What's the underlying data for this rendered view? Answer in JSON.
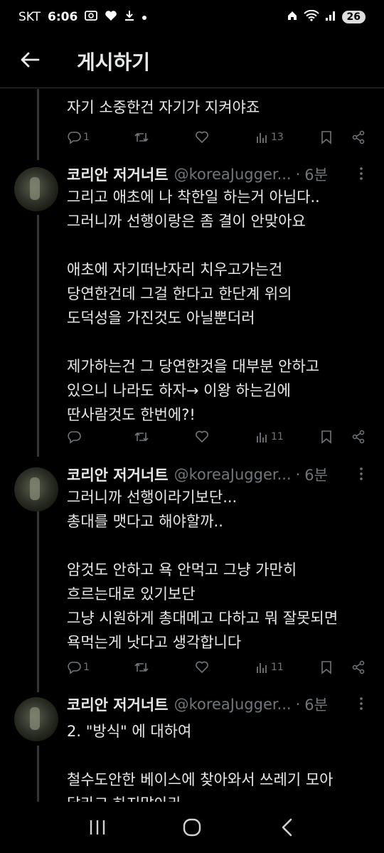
{
  "status_bar": {
    "carrier": "SKT",
    "time": "6:06",
    "battery": "26"
  },
  "header": {
    "title": "게시하기"
  },
  "tweets": [
    {
      "text": "자기 소중한건 자기가 지켜야죠",
      "replies": "1",
      "views": "13"
    },
    {
      "name": "코리안 저거너트",
      "handle": "@koreaJugger...",
      "dot": "·",
      "ago": "6분",
      "text": "그리고 애초에  나 착한일 하는거 아님다..\n그러니까 선행이랑은 좀 결이 안맞아요\n\n애초에 자기떠난자리 치우고가는건\n당연한건데 그걸 한다고  한단계 위의\n도덕성을 가진것도 아닐뿐더러\n\n제가하는건 그 당연한것을  대부분 안하고\n있으니  나라도 하자→ 이왕 하는김에\n딴사람것도 한번에?!",
      "replies": "",
      "views": "11"
    },
    {
      "name": "코리안 저거너트",
      "handle": "@koreaJugger...",
      "dot": "·",
      "ago": "6분",
      "text": "그러니까 선행이라기보단...\n총대를 맷다고 해야할까..\n\n암것도 안하고 욕 안먹고 그냥 가만히\n흐르는대로 있기보단\n그냥 시원하게 총대메고 다하고 뭐 잘못되면\n욕먹는게 낫다고 생각합니다",
      "replies": "1",
      "views": "11"
    },
    {
      "name": "코리안 저거너트",
      "handle": "@koreaJugger...",
      "dot": "·",
      "ago": "6분",
      "text": "2. \"방식\" 에 대하여\n\n철수도안한 베이스에 찾아와서 쓰레기 모아\n달라고 하지말아라"
    }
  ],
  "icons": {
    "back": "arrow-left-icon",
    "reply": "reply-bubble-icon",
    "retweet": "retweet-icon",
    "like": "heart-icon",
    "views": "views-bar-chart-icon",
    "bookmark": "bookmark-icon",
    "share": "share-icon",
    "more": "more-dots-icon"
  },
  "colors": {
    "background": "#000000",
    "text": "#e7e9ea",
    "muted": "#71767b",
    "divider": "#2f3336"
  }
}
